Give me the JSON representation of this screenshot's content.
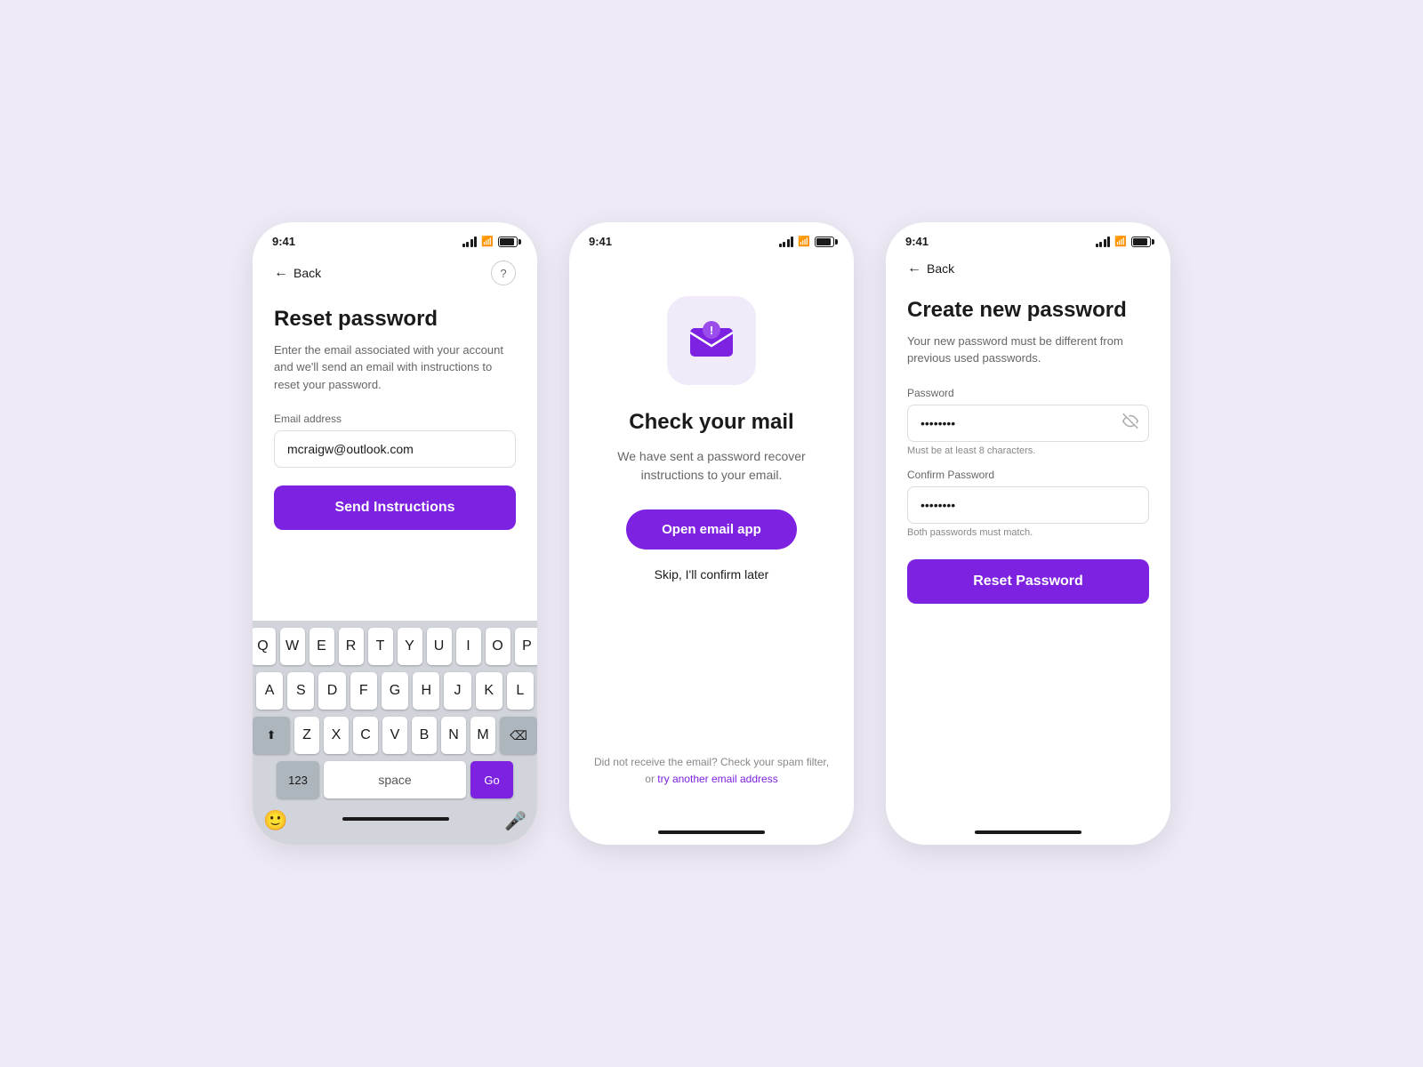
{
  "background": "#eeeaf6",
  "accent_color": "#7c22e0",
  "screens": [
    {
      "id": "reset-password",
      "status_time": "9:41",
      "nav_back": "Back",
      "title": "Reset password",
      "subtitle": "Enter the email associated with your account and we'll send an email with instructions to reset your password.",
      "email_label": "Email address",
      "email_value": "mcraigw@outlook.com",
      "send_btn": "Send Instructions",
      "keyboard": {
        "row1": [
          "Q",
          "W",
          "E",
          "R",
          "T",
          "Y",
          "U",
          "I",
          "O",
          "P"
        ],
        "row2": [
          "A",
          "S",
          "D",
          "F",
          "G",
          "H",
          "J",
          "K",
          "L"
        ],
        "row3": [
          "Z",
          "X",
          "C",
          "V",
          "B",
          "N",
          "M"
        ],
        "special_123": "123",
        "space": "space",
        "go": "Go"
      }
    },
    {
      "id": "check-mail",
      "status_time": "9:41",
      "title": "Check your mail",
      "description": "We have sent a password recover instructions to your email.",
      "open_btn": "Open email app",
      "skip_link": "Skip, I'll confirm later",
      "footer_text": "Did not receive the email? Check your spam filter,",
      "footer_link": "try another email address",
      "footer_prefix": "or "
    },
    {
      "id": "create-password",
      "status_time": "9:41",
      "nav_back": "Back",
      "title": "Create new password",
      "subtitle": "Your new password must be different from previous used passwords.",
      "password_label": "Password",
      "password_value": "••••••••",
      "password_hint": "Must be at least 8 characters.",
      "confirm_label": "Confirm Password",
      "confirm_value": "••••••••",
      "confirm_hint": "Both passwords must match.",
      "reset_btn": "Reset Password"
    }
  ]
}
